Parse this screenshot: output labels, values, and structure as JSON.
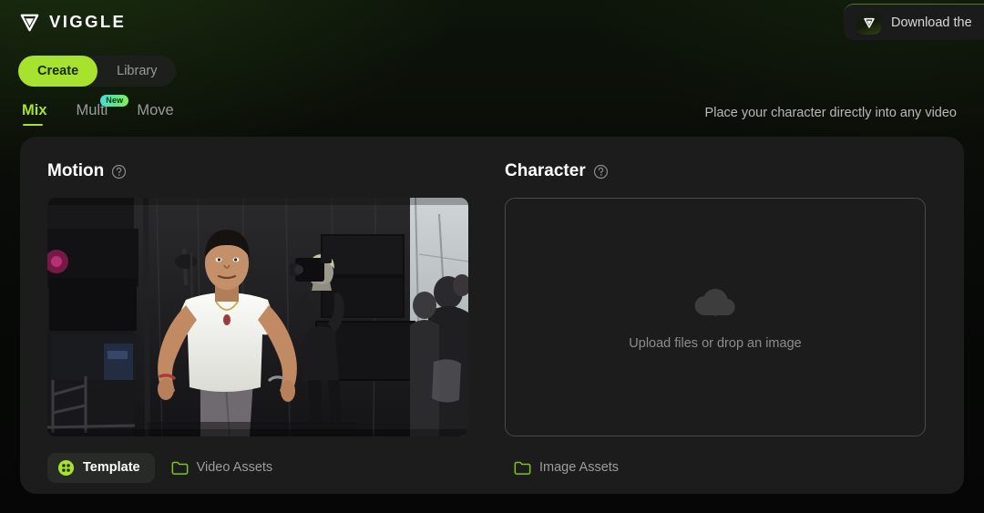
{
  "brand": {
    "name": "VIGGLE",
    "logo_icon": "viggle-v-logo"
  },
  "download_banner": {
    "text": "Download the",
    "app_icon": "viggle-app-icon"
  },
  "segmented": {
    "create_label": "Create",
    "library_label": "Library",
    "active": "Create"
  },
  "mode_tabs": {
    "items": [
      {
        "label": "Mix",
        "active": true,
        "badge": null
      },
      {
        "label": "Multi",
        "active": false,
        "badge": "New"
      },
      {
        "label": "Move",
        "active": false,
        "badge": null
      }
    ]
  },
  "tagline": "Place your character directly into any video",
  "motion": {
    "title": "Motion",
    "help_icon": "question-circle-icon",
    "template_label": "Template",
    "template_icon": "grid-circle-icon",
    "video_assets_label": "Video Assets",
    "video_assets_icon": "folder-icon"
  },
  "character": {
    "title": "Character",
    "help_icon": "question-circle-icon",
    "upload_icon": "cloud-upload-icon",
    "upload_text": "Upload files or drop an image",
    "image_assets_label": "Image Assets",
    "image_assets_icon": "folder-icon"
  },
  "colors": {
    "accent_green": "#a6e22e",
    "card_bg": "#1b1c1b",
    "page_bg": "#060806",
    "badge_gradient_start": "#3fe0e0",
    "badge_gradient_end": "#8bf04a",
    "muted_text": "#9a9a9a"
  }
}
